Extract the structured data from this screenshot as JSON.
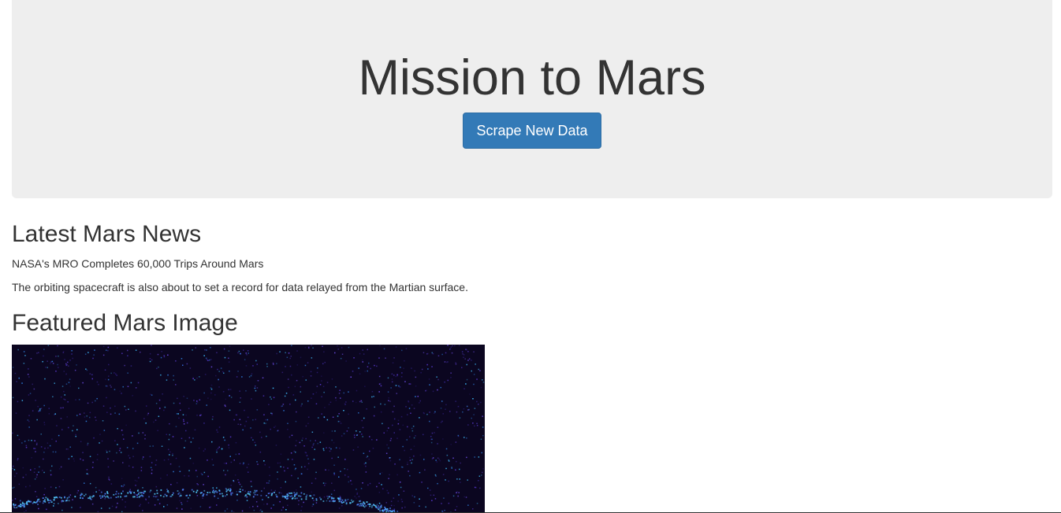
{
  "header": {
    "title": "Mission to Mars",
    "scrape_button_label": "Scrape New Data"
  },
  "news": {
    "heading": "Latest Mars News",
    "title": "NASA's MRO Completes 60,000 Trips Around Mars",
    "paragraph": "The orbiting spacecraft is also about to set a record for data relayed from the Martian surface."
  },
  "featured_image": {
    "heading": "Featured Mars Image"
  },
  "colors": {
    "jumbotron_bg": "#eeeeee",
    "button_bg": "#337ab7",
    "text": "#333333"
  }
}
